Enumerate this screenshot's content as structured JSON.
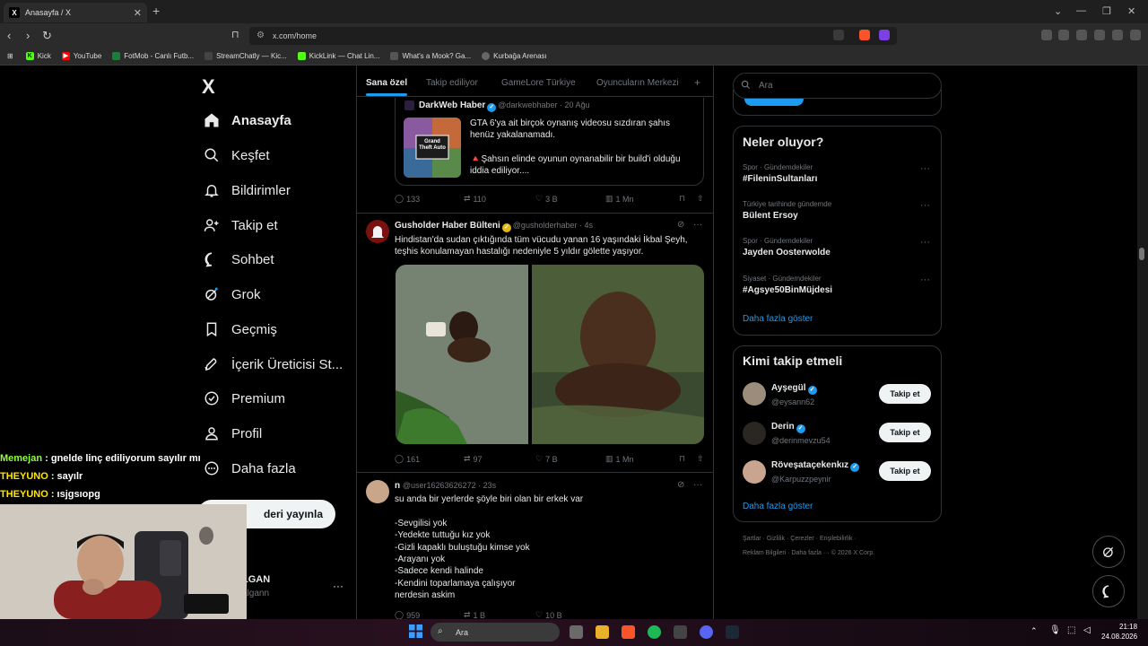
{
  "browser": {
    "tab_title": "Anasayfa / X",
    "tab_close": "✕",
    "new_tab": "+",
    "address": "x.com/home",
    "bookmarks": [
      {
        "label": "Kick",
        "color": "#53fc18"
      },
      {
        "label": "YouTube",
        "color": "#ff0000"
      },
      {
        "label": "FotMob - Canlı Futb...",
        "color": "#1a7f37"
      },
      {
        "label": "StreamChatly — Kic...",
        "color": "#444444"
      },
      {
        "label": "KickLink — Chat Lin...",
        "color": "#53fc18"
      },
      {
        "label": "What's a Mook? Ga...",
        "color": "#555555"
      },
      {
        "label": "Kurbağa Arenası",
        "color": "#666666"
      }
    ]
  },
  "sidebar": {
    "logo": "X",
    "items": [
      {
        "label": "Anasayfa",
        "icon": "home-icon",
        "active": true
      },
      {
        "label": "Keşfet",
        "icon": "search-icon"
      },
      {
        "label": "Bildirimler",
        "icon": "bell-icon"
      },
      {
        "label": "Takip et",
        "icon": "add-person-icon"
      },
      {
        "label": "Sohbet",
        "icon": "chat-icon"
      },
      {
        "label": "Grok",
        "icon": "grok-icon"
      },
      {
        "label": "Geçmiş",
        "icon": "bookmark-icon"
      },
      {
        "label": "İçerik Üreticisi St...",
        "icon": "rocket-icon"
      },
      {
        "label": "Premium",
        "icon": "premium-icon"
      },
      {
        "label": "Profil",
        "icon": "person-icon"
      },
      {
        "label": "Daha fazla",
        "icon": "more-circle-icon"
      }
    ],
    "post_button": "deri yayınla",
    "account_name": "LGAN",
    "account_handle": "algann",
    "account_more": "···"
  },
  "chat_overlay": [
    {
      "user": "Memejan",
      "color": "#8cff3b",
      "message": " : gnelde linç ediliyorum sayılır mı"
    },
    {
      "user": "THEYUNO",
      "color": "#ffe500",
      "message": " : sayılr"
    },
    {
      "user": "THEYUNO",
      "color": "#ffe500",
      "message": " : ısjgsıopg"
    }
  ],
  "feed": {
    "tabs": [
      "Sana özel",
      "Takip ediliyor",
      "GameLore Türkiye",
      "Oyuncuların Merkezi",
      "+"
    ],
    "posts": [
      {
        "quoted_name": "DarkWeb Haber",
        "quoted_handle": "@darkwebhaber · 20 Ağu",
        "quoted_text_1": "GTA 6'ya ait birçok oynanış videosu sızdıran şahıs henüz yakalanamadı.",
        "quoted_text_2": "🔺Şahsın elinde oyunun oynanabilir bir build'i olduğu iddia ediliyor....",
        "thumb_label": "Grand Theft Auto",
        "replies": "133",
        "reposts": "110",
        "likes": "3 B",
        "views": "1 Mn"
      },
      {
        "name": "Gusholder Haber Bülteni",
        "handle": "@gusholderhaber · 4s",
        "text": "Hindistan'da sudan çıktığında tüm vücudu yanan 16 yaşındaki İkbal Şeyh, teşhis konulamayan hastalığı nedeniyle 5 yıldır gölette yaşıyor.",
        "replies": "161",
        "reposts": "97",
        "likes": "7 B",
        "views": "1 Mn"
      },
      {
        "name": "n",
        "handle": "@user16263626272 · 23s",
        "text_lines": [
          "su anda bir yerlerde şöyle biri olan bir erkek var",
          "",
          "-Sevgilisi yok",
          "-Yedekte tuttuğu kız yok",
          "-Gizli kapaklı buluştuğu kimse yok",
          "-Arayanı yok",
          "-Sadece kendi halinde",
          "-Kendini toparlamaya çalışıyor",
          "nerdesin askim"
        ],
        "replies": "959",
        "reposts": "1 B",
        "likes": "10 B",
        "views": ""
      }
    ]
  },
  "right": {
    "search_placeholder": "Ara",
    "trends_title": "Neler oluyor?",
    "trends": [
      {
        "meta": "Spor · Gündemdekiler",
        "name": "#FileninSultanları"
      },
      {
        "meta": "Türkiye tarihinde gündemde",
        "name": "Bülent Ersoy"
      },
      {
        "meta": "Spor · Gündemdekiler",
        "name": "Jayden Oosterwolde"
      },
      {
        "meta": "Siyaset · Gündemdekiler",
        "name": "#Agsye50BinMüjdesi"
      }
    ],
    "show_more": "Daha fazla göster",
    "who_title": "Kimi takip etmeli",
    "who": [
      {
        "name": "Ayşegül",
        "handle": "@eysann62",
        "button": "Takip et"
      },
      {
        "name": "Derin",
        "handle": "@derinmevzu54",
        "button": "Takip et"
      },
      {
        "name": "Röveşataçekenkız",
        "handle": "@Karpuzzpeynir",
        "button": "Takip et"
      }
    ],
    "footer_1": "Şartlar  ·  Gizlilik  ·  Çerezler  ·  Erişilebilirlik  ·",
    "footer_2": "Reklam Bilgileri  ·  Daha fazla ···  © 2026 X Corp."
  },
  "taskbar": {
    "search": "Ara",
    "time": "21:18",
    "date": "24.08.2026"
  }
}
